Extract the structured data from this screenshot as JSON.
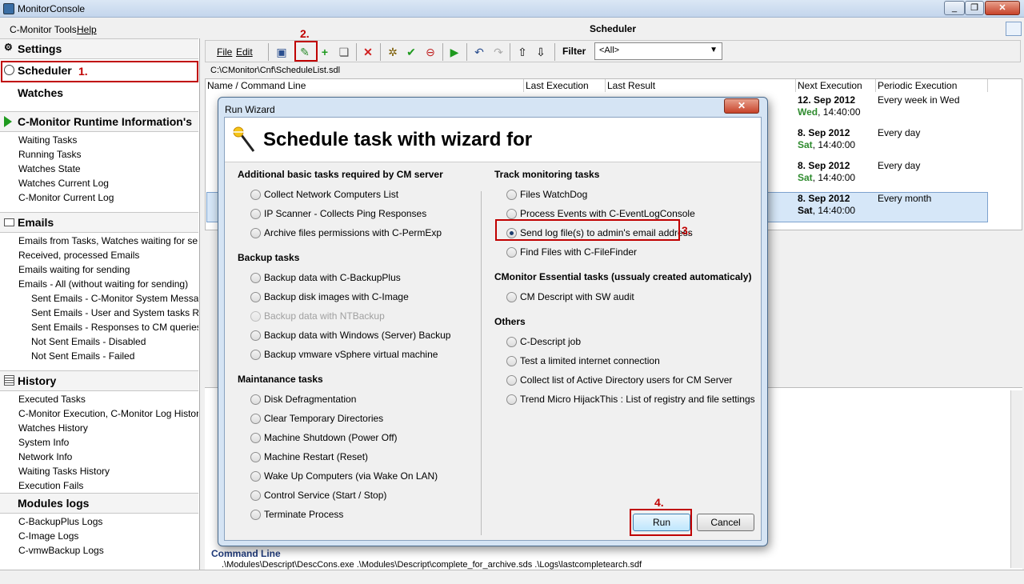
{
  "app": {
    "title": "MonitorConsole"
  },
  "menu": {
    "tools": "C-Monitor Tools",
    "help": "Help"
  },
  "sidebar": {
    "settings": "Settings",
    "scheduler": "Scheduler",
    "watches": "Watches",
    "runtime": {
      "title": "C-Monitor Runtime Information's",
      "items": [
        "Waiting Tasks",
        "Running Tasks",
        "Watches State",
        "Watches Current Log",
        "C-Monitor Current Log"
      ]
    },
    "emails": {
      "title": "Emails",
      "items": [
        "Emails from Tasks, Watches waiting for sending",
        "Received, processed Emails",
        "Emails waiting for sending",
        "Emails - All (without waiting for sending)"
      ],
      "subitems": [
        "Sent Emails - C-Monitor System Messages",
        "Sent Emails - User and System tasks Results",
        "Sent Emails - Responses to CM queries",
        "Not Sent Emails - Disabled",
        "Not Sent Emails - Failed"
      ]
    },
    "history": {
      "title": "History",
      "items": [
        "Executed Tasks",
        "C-Monitor Execution, C-Monitor Log History",
        "Watches History",
        "System Info",
        "Network Info",
        "Waiting Tasks History",
        "Execution Fails"
      ]
    },
    "modules": {
      "title": "Modules logs",
      "items": [
        "C-BackupPlus Logs",
        "C-Image Logs",
        "C-vmwBackup Logs"
      ]
    }
  },
  "main": {
    "title": "Scheduler",
    "toolbar": {
      "file": "File",
      "edit": "Edit",
      "filter_label": "Filter",
      "filter_value": "<All>"
    },
    "path": "C:\\CMonitor\\Cnf\\ScheduleList.sdl",
    "columns": [
      "Name / Command Line",
      "Last Execution",
      "Last Result",
      "Next Execution",
      "Periodic Execution"
    ],
    "rows": [
      {
        "date": "12. Sep 2012",
        "day": "Wed",
        "time": ", 14:40:00",
        "period": "Every week in Wed"
      },
      {
        "date": "8. Sep 2012",
        "day": "Sat",
        "time": ", 14:40:00",
        "period": "Every day"
      },
      {
        "date": "8. Sep 2012",
        "day": "Sat",
        "time": ", 14:40:00",
        "period": "Every day"
      },
      {
        "date": "8. Sep 2012",
        "day": "Sat",
        "time": ", 14:40:00",
        "period": "Every month"
      }
    ],
    "details": {
      "command_heading": "Command Line",
      "command": ".\\Modules\\Descript\\DescCons.exe .\\Modules\\Descript\\complete_for_archive.sds .\\Logs\\lastcompletearch.sdf"
    }
  },
  "dialog": {
    "title": "Run Wizard",
    "heading": "Schedule task with wizard for",
    "left": [
      {
        "group": "Additional basic tasks required by CM server",
        "options": [
          "Collect Network Computers List",
          "IP Scanner - Collects Ping Responses",
          "Archive files permissions with C-PermExp"
        ]
      },
      {
        "group": "Backup tasks",
        "options": [
          "Backup data with C-BackupPlus",
          "Backup disk images with C-Image",
          "Backup data with NTBackup",
          "Backup data with Windows (Server) Backup",
          "Backup vmware vSphere virtual machine"
        ]
      },
      {
        "group": "Maintanance tasks",
        "options": [
          "Disk Defragmentation",
          "Clear Temporary Directories",
          "Machine Shutdown (Power Off)",
          "Machine Restart (Reset)",
          "Wake Up Computers (via Wake On LAN)",
          "Control Service (Start / Stop)",
          "Terminate Process"
        ]
      }
    ],
    "right": [
      {
        "group": "Track monitoring tasks",
        "options": [
          "Files WatchDog",
          "Process Events with C-EventLogConsole",
          "Send log file(s) to admin's email address",
          "Find Files with C-FileFinder"
        ]
      },
      {
        "group": "CMonitor Essential tasks (ussualy created automaticaly)",
        "options": [
          "CM Descript with SW audit"
        ]
      },
      {
        "group": "Others",
        "options": [
          "C-Descript job",
          "Test a limited internet connection",
          "Collect list of Active Directory users for CM Server",
          "Trend Micro HijackThis : List of registry and file settings"
        ]
      }
    ],
    "selected": "Send log file(s) to admin's email address",
    "run_label": "Run",
    "cancel_label": "Cancel"
  },
  "annotations": {
    "step1": "1.",
    "step2": "2.",
    "step3": "3.",
    "step4": "4.",
    "color": "#c00000"
  }
}
